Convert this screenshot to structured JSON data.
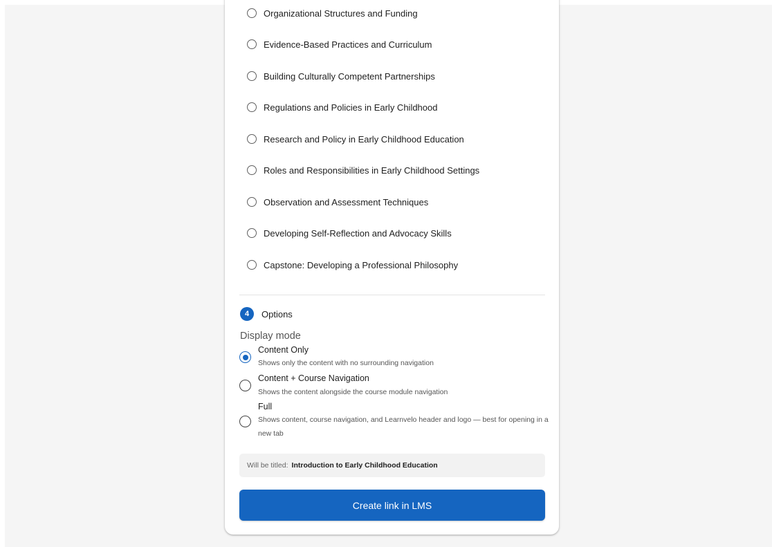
{
  "modules": [
    {
      "label": "Organizational Structures and Funding",
      "selected": false
    },
    {
      "label": "Evidence-Based Practices and Curriculum",
      "selected": false
    },
    {
      "label": "Building Culturally Competent Partnerships",
      "selected": false
    },
    {
      "label": "Regulations and Policies in Early Childhood",
      "selected": false
    },
    {
      "label": "Research and Policy in Early Childhood Education",
      "selected": false
    },
    {
      "label": "Roles and Responsibilities in Early Childhood Settings",
      "selected": false
    },
    {
      "label": "Observation and Assessment Techniques",
      "selected": false
    },
    {
      "label": "Developing Self-Reflection and Advocacy Skills",
      "selected": false
    },
    {
      "label": "Capstone: Developing a Professional Philosophy",
      "selected": false
    }
  ],
  "options_step": {
    "number": "4",
    "title": "Options",
    "display_mode_label": "Display mode",
    "modes": [
      {
        "title": "Content Only",
        "description": "Shows only the content with no surrounding navigation",
        "selected": true
      },
      {
        "title": "Content + Course Navigation",
        "description": "Shows the content alongside the course module navigation",
        "selected": false
      },
      {
        "title": "Full",
        "description": "Shows content, course navigation, and Learnvelo header and logo — best for opening in a new tab",
        "selected": false
      }
    ]
  },
  "title_preview": {
    "prefix": "Will be titled:",
    "value": "Introduction to Early Childhood Education"
  },
  "create_button_label": "Create link in LMS",
  "colors": {
    "accent": "#1565c0",
    "page_background": "#f5f5f5",
    "card_background": "#ffffff"
  }
}
